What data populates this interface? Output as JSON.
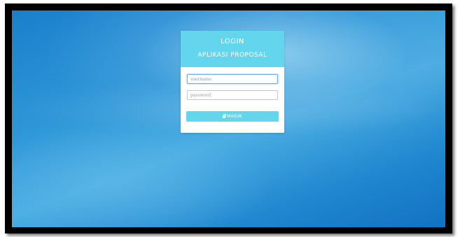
{
  "header": {
    "title": "LOGIN",
    "subtitle": "APLIKASI PROPOSAL"
  },
  "form": {
    "username_placeholder": "username",
    "password_placeholder": "password",
    "submit_label": "MASUK",
    "submit_icon": "lock-icon"
  },
  "colors": {
    "accent": "#63d6ee",
    "background": "#1f86cf",
    "card": "#ffffff",
    "frame": "#000000"
  }
}
